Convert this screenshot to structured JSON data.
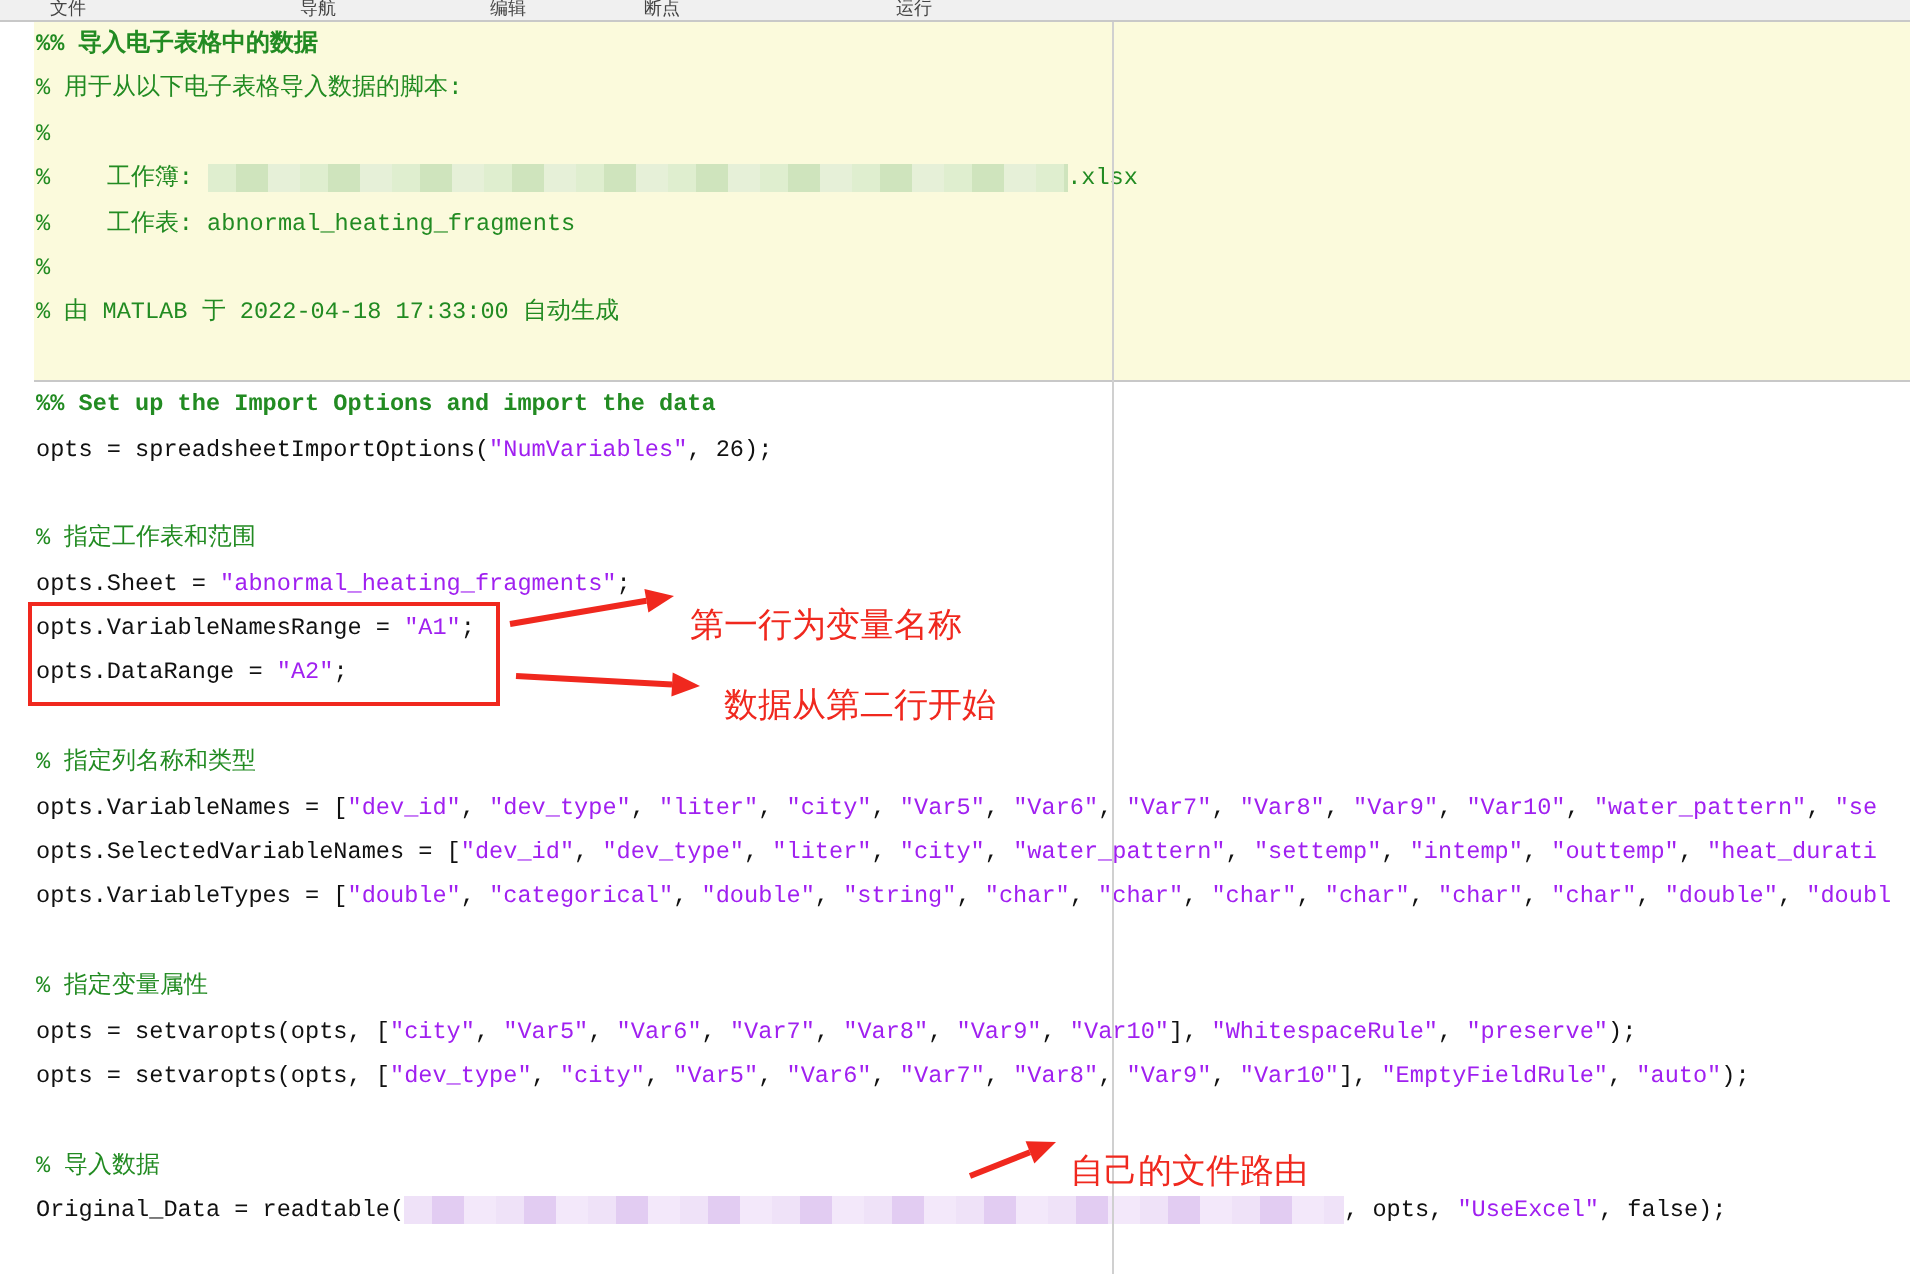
{
  "toolstrip": {
    "sections": [
      "文件",
      "导航",
      "编辑",
      "断点",
      "运行"
    ]
  },
  "cells": [
    {
      "highlighted": true,
      "lines": [
        {
          "kind": "code",
          "segments": [
            {
              "kind": "cell_title",
              "text": "%% 导入电子表格中的数据"
            }
          ]
        },
        {
          "kind": "code",
          "segments": [
            {
              "kind": "comment",
              "text": "% 用于从以下电子表格导入数据的脚本:"
            }
          ]
        },
        {
          "kind": "code",
          "segments": [
            {
              "kind": "comment",
              "text": "%"
            }
          ]
        },
        {
          "kind": "code",
          "segments": [
            {
              "kind": "comment",
              "text": "%    工作簿: "
            },
            {
              "kind": "blurred_comment"
            },
            {
              "kind": "comment",
              "text": ".xlsx"
            }
          ]
        },
        {
          "kind": "code",
          "segments": [
            {
              "kind": "comment",
              "text": "%    工作表: abnormal_heating_fragments"
            }
          ]
        },
        {
          "kind": "code",
          "segments": [
            {
              "kind": "comment",
              "text": "%"
            }
          ]
        },
        {
          "kind": "code",
          "segments": [
            {
              "kind": "comment",
              "text": "% 由 MATLAB 于 2022-04-18 17:33:00 自动生成"
            }
          ]
        },
        {
          "kind": "blank"
        }
      ]
    },
    {
      "highlighted": false,
      "lines": [
        {
          "kind": "code",
          "segments": [
            {
              "kind": "cell_title",
              "text": "%% Set up the Import Options and import the data"
            }
          ]
        },
        {
          "kind": "code",
          "segments": [
            {
              "kind": "code",
              "text": "opts = spreadsheetImportOptions("
            },
            {
              "kind": "string",
              "text": "\"NumVariables\""
            },
            {
              "kind": "code",
              "text": ", 26);"
            }
          ]
        },
        {
          "kind": "blank"
        },
        {
          "kind": "code",
          "segments": [
            {
              "kind": "comment",
              "text": "% 指定工作表和范围"
            }
          ]
        },
        {
          "kind": "code",
          "segments": [
            {
              "kind": "code",
              "text": "opts.Sheet = "
            },
            {
              "kind": "string",
              "text": "\"abnormal_heating_fragments\""
            },
            {
              "kind": "code",
              "text": ";"
            }
          ]
        },
        {
          "kind": "code",
          "segments": [
            {
              "kind": "code",
              "text": "opts.VariableNamesRange = "
            },
            {
              "kind": "string",
              "text": "\"A1\""
            },
            {
              "kind": "code",
              "text": ";"
            }
          ]
        },
        {
          "kind": "code",
          "segments": [
            {
              "kind": "code",
              "text": "opts.DataRange = "
            },
            {
              "kind": "string",
              "text": "\"A2\""
            },
            {
              "kind": "code",
              "text": ";"
            }
          ]
        },
        {
          "kind": "blank"
        },
        {
          "kind": "code",
          "segments": [
            {
              "kind": "comment",
              "text": "% 指定列名称和类型"
            }
          ]
        },
        {
          "kind": "code",
          "segments": [
            {
              "kind": "code",
              "text": "opts.VariableNames = ["
            },
            {
              "kind": "string",
              "text": "\"dev_id\""
            },
            {
              "kind": "code",
              "text": ", "
            },
            {
              "kind": "string",
              "text": "\"dev_type\""
            },
            {
              "kind": "code",
              "text": ", "
            },
            {
              "kind": "string",
              "text": "\"liter\""
            },
            {
              "kind": "code",
              "text": ", "
            },
            {
              "kind": "string",
              "text": "\"city\""
            },
            {
              "kind": "code",
              "text": ", "
            },
            {
              "kind": "string",
              "text": "\"Var5\""
            },
            {
              "kind": "code",
              "text": ", "
            },
            {
              "kind": "string",
              "text": "\"Var6\""
            },
            {
              "kind": "code",
              "text": ", "
            },
            {
              "kind": "string",
              "text": "\"Var7\""
            },
            {
              "kind": "code",
              "text": ", "
            },
            {
              "kind": "string",
              "text": "\"Var8\""
            },
            {
              "kind": "code",
              "text": ", "
            },
            {
              "kind": "string",
              "text": "\"Var9\""
            },
            {
              "kind": "code",
              "text": ", "
            },
            {
              "kind": "string",
              "text": "\"Var10\""
            },
            {
              "kind": "code",
              "text": ", "
            },
            {
              "kind": "string",
              "text": "\"water_pattern\""
            },
            {
              "kind": "code",
              "text": ", "
            },
            {
              "kind": "string",
              "text": "\"se"
            }
          ]
        },
        {
          "kind": "code",
          "segments": [
            {
              "kind": "code",
              "text": "opts.SelectedVariableNames = ["
            },
            {
              "kind": "string",
              "text": "\"dev_id\""
            },
            {
              "kind": "code",
              "text": ", "
            },
            {
              "kind": "string",
              "text": "\"dev_type\""
            },
            {
              "kind": "code",
              "text": ", "
            },
            {
              "kind": "string",
              "text": "\"liter\""
            },
            {
              "kind": "code",
              "text": ", "
            },
            {
              "kind": "string",
              "text": "\"city\""
            },
            {
              "kind": "code",
              "text": ", "
            },
            {
              "kind": "string",
              "text": "\"water_pattern\""
            },
            {
              "kind": "code",
              "text": ", "
            },
            {
              "kind": "string",
              "text": "\"settemp\""
            },
            {
              "kind": "code",
              "text": ", "
            },
            {
              "kind": "string",
              "text": "\"intemp\""
            },
            {
              "kind": "code",
              "text": ", "
            },
            {
              "kind": "string",
              "text": "\"outtemp\""
            },
            {
              "kind": "code",
              "text": ", "
            },
            {
              "kind": "string",
              "text": "\"heat_durati"
            }
          ]
        },
        {
          "kind": "code",
          "segments": [
            {
              "kind": "code",
              "text": "opts.VariableTypes = ["
            },
            {
              "kind": "string",
              "text": "\"double\""
            },
            {
              "kind": "code",
              "text": ", "
            },
            {
              "kind": "string",
              "text": "\"categorical\""
            },
            {
              "kind": "code",
              "text": ", "
            },
            {
              "kind": "string",
              "text": "\"double\""
            },
            {
              "kind": "code",
              "text": ", "
            },
            {
              "kind": "string",
              "text": "\"string\""
            },
            {
              "kind": "code",
              "text": ", "
            },
            {
              "kind": "string",
              "text": "\"char\""
            },
            {
              "kind": "code",
              "text": ", "
            },
            {
              "kind": "string",
              "text": "\"char\""
            },
            {
              "kind": "code",
              "text": ", "
            },
            {
              "kind": "string",
              "text": "\"char\""
            },
            {
              "kind": "code",
              "text": ", "
            },
            {
              "kind": "string",
              "text": "\"char\""
            },
            {
              "kind": "code",
              "text": ", "
            },
            {
              "kind": "string",
              "text": "\"char\""
            },
            {
              "kind": "code",
              "text": ", "
            },
            {
              "kind": "string",
              "text": "\"char\""
            },
            {
              "kind": "code",
              "text": ", "
            },
            {
              "kind": "string",
              "text": "\"double\""
            },
            {
              "kind": "code",
              "text": ", "
            },
            {
              "kind": "string",
              "text": "\"doubl"
            }
          ]
        },
        {
          "kind": "blank"
        },
        {
          "kind": "code",
          "segments": [
            {
              "kind": "comment",
              "text": "% 指定变量属性"
            }
          ]
        },
        {
          "kind": "code",
          "segments": [
            {
              "kind": "code",
              "text": "opts = setvaropts(opts, ["
            },
            {
              "kind": "string",
              "text": "\"city\""
            },
            {
              "kind": "code",
              "text": ", "
            },
            {
              "kind": "string",
              "text": "\"Var5\""
            },
            {
              "kind": "code",
              "text": ", "
            },
            {
              "kind": "string",
              "text": "\"Var6\""
            },
            {
              "kind": "code",
              "text": ", "
            },
            {
              "kind": "string",
              "text": "\"Var7\""
            },
            {
              "kind": "code",
              "text": ", "
            },
            {
              "kind": "string",
              "text": "\"Var8\""
            },
            {
              "kind": "code",
              "text": ", "
            },
            {
              "kind": "string",
              "text": "\"Var9\""
            },
            {
              "kind": "code",
              "text": ", "
            },
            {
              "kind": "string",
              "text": "\"Var10\""
            },
            {
              "kind": "code",
              "text": "], "
            },
            {
              "kind": "string",
              "text": "\"WhitespaceRule\""
            },
            {
              "kind": "code",
              "text": ", "
            },
            {
              "kind": "string",
              "text": "\"preserve\""
            },
            {
              "kind": "code",
              "text": ");"
            }
          ]
        },
        {
          "kind": "code",
          "segments": [
            {
              "kind": "code",
              "text": "opts = setvaropts(opts, ["
            },
            {
              "kind": "string",
              "text": "\"dev_type\""
            },
            {
              "kind": "code",
              "text": ", "
            },
            {
              "kind": "string",
              "text": "\"city\""
            },
            {
              "kind": "code",
              "text": ", "
            },
            {
              "kind": "string",
              "text": "\"Var5\""
            },
            {
              "kind": "code",
              "text": ", "
            },
            {
              "kind": "string",
              "text": "\"Var6\""
            },
            {
              "kind": "code",
              "text": ", "
            },
            {
              "kind": "string",
              "text": "\"Var7\""
            },
            {
              "kind": "code",
              "text": ", "
            },
            {
              "kind": "string",
              "text": "\"Var8\""
            },
            {
              "kind": "code",
              "text": ", "
            },
            {
              "kind": "string",
              "text": "\"Var9\""
            },
            {
              "kind": "code",
              "text": ", "
            },
            {
              "kind": "string",
              "text": "\"Var10\""
            },
            {
              "kind": "code",
              "text": "], "
            },
            {
              "kind": "string",
              "text": "\"EmptyFieldRule\""
            },
            {
              "kind": "code",
              "text": ", "
            },
            {
              "kind": "string",
              "text": "\"auto\""
            },
            {
              "kind": "code",
              "text": ");"
            }
          ]
        },
        {
          "kind": "blank"
        },
        {
          "kind": "code",
          "segments": [
            {
              "kind": "comment",
              "text": "% 导入数据"
            }
          ]
        },
        {
          "kind": "code",
          "segments": [
            {
              "kind": "code",
              "text": "Original_Data = readtable("
            },
            {
              "kind": "blurred_string"
            },
            {
              "kind": "code",
              "text": ", opts, "
            },
            {
              "kind": "string",
              "text": "\"UseExcel\""
            },
            {
              "kind": "code",
              "text": ", false);"
            }
          ]
        }
      ]
    }
  ],
  "annotations": [
    {
      "text": "第一行为变量名称"
    },
    {
      "text": "数据从第二行开始"
    },
    {
      "text": "自己的文件路由"
    }
  ]
}
